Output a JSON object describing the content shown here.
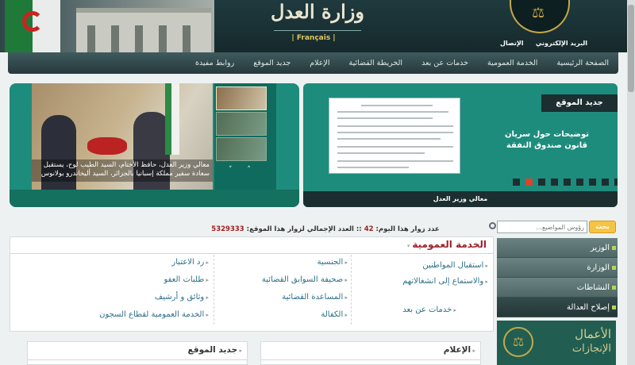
{
  "header": {
    "title": "وزارة العدل",
    "lang_link": "Français",
    "links": [
      "البريد الإلكتروني",
      "الإتصال"
    ],
    "emblem_icon": "scales-of-justice-icon"
  },
  "nav": {
    "items": [
      "الصفحة الرئيسية",
      "الخدمة العمومية",
      "خدمات عن بعد",
      "الخريطة القضائية",
      "الإعلام",
      "جديد الموقع",
      "روابط مفيدة"
    ]
  },
  "slider": {
    "caption": "معالي وزير العدل، حافظ الأختام، السيد الطيب لوح، يستقبل سعادة سفير مملكة إسبانيا بالجزائر، السيد أليخاندرو بولانوس",
    "arrows": "˅ ˄"
  },
  "news": {
    "header": "جديد الموقع",
    "title": "توضيحات حول سريان قانون صندوق النفقة",
    "footer": "معالي وزير العدل",
    "active_dot": 1,
    "dot_count": 9
  },
  "search": {
    "placeholder": "رؤوس المواضيع...",
    "button": "بحث"
  },
  "sidebar": {
    "items": [
      "الوزير",
      "الوزارة",
      "النشاطات",
      "إصلاح العدالة"
    ],
    "active_index": 3,
    "ad_line1": "الأعمال",
    "ad_line2": "الإنجازات"
  },
  "counter": {
    "today_label": "عدد زوار هذا اليوم:",
    "today_value": "42",
    "sep": "::",
    "total_label": "العدد الإجمالي لزوار هذا الموقع:",
    "total_value": "5329333"
  },
  "services": {
    "title": "الخدمة العمومية",
    "col1": [
      "استقبال المواطنين",
      "والاستماع إلى انشغالاتهم",
      "خدمات عن بعد"
    ],
    "col2": [
      "الجنسية",
      "صحيفة السوابق القضائية",
      "المساعدة القضائية",
      "الكفالة"
    ],
    "col3": [
      "رد الاعتبار",
      "طلبات العفو",
      "وثائق و أرشيف",
      "الخدمة العمومية لقطاع السجون"
    ]
  },
  "panels": {
    "media": "الإعلام",
    "new": "جديد الموقع"
  }
}
